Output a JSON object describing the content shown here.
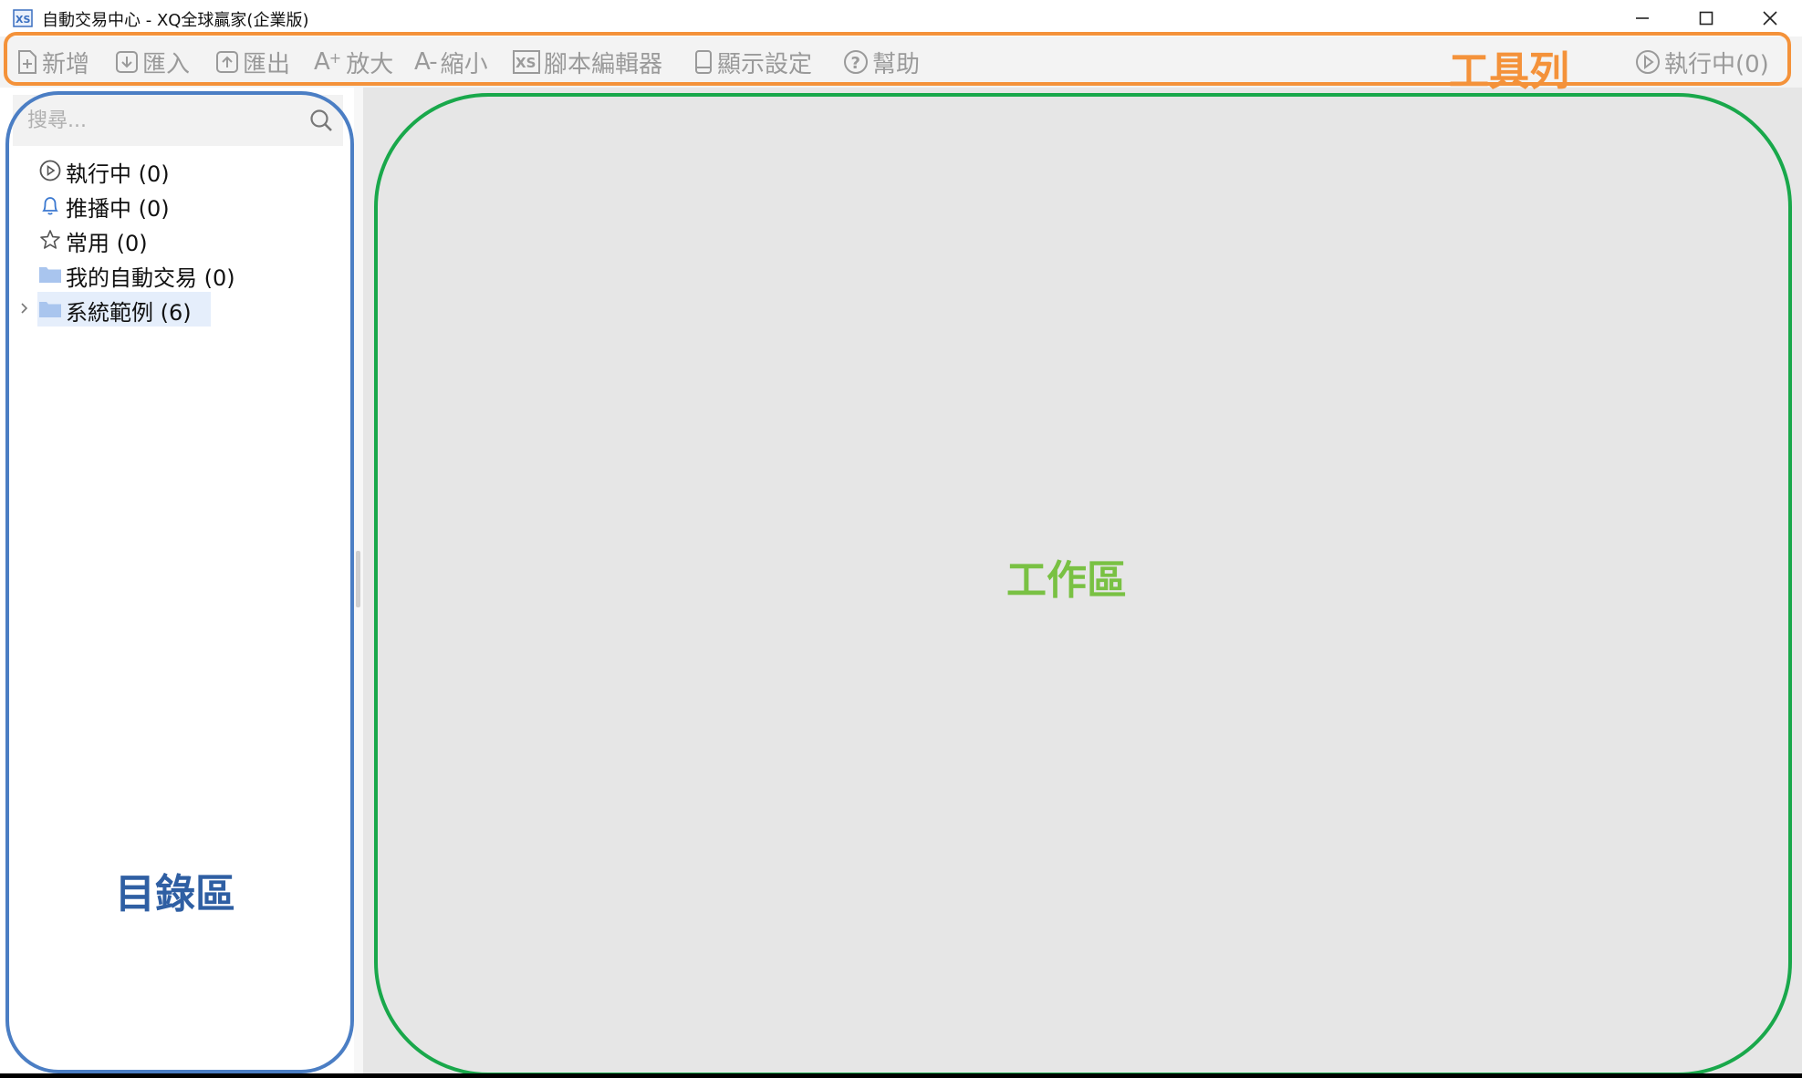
{
  "window": {
    "title": "自動交易中心 - XQ全球贏家(企業版)",
    "app_icon": "xs-logo-icon",
    "controls": [
      "minimize-icon",
      "maximize-icon",
      "close-icon"
    ]
  },
  "toolbar": {
    "new_label": "新增",
    "import_label": "匯入",
    "export_label": "匯出",
    "zoom_in_prefix": "A",
    "zoom_in_label": "放大",
    "zoom_out_prefix": "A-",
    "zoom_out_label": "縮小",
    "script_editor_label": "腳本編輯器",
    "display_settings_label": "顯示設定",
    "help_label": "幫助",
    "running_label": "執行中(0)"
  },
  "search": {
    "placeholder": "搜尋..."
  },
  "tree": {
    "items": [
      {
        "label": "執行中 (0)",
        "icon": "play-circle-icon"
      },
      {
        "label": "推播中 (0)",
        "icon": "bell-icon"
      },
      {
        "label": "常用 (0)",
        "icon": "star-icon"
      },
      {
        "label": "我的自動交易 (0)",
        "icon": "folder-icon"
      },
      {
        "label": "系統範例 (6)",
        "icon": "folder-icon",
        "expandable": true,
        "selected": true
      }
    ]
  },
  "annotations": {
    "toolbar_label": "工具列",
    "directory_label": "目錄區",
    "workarea_label": "工作區"
  },
  "colors": {
    "toolbar_annotation": "#f4923a",
    "directory_annotation": "#4b7ec4",
    "workarea_annotation": "#19a84b",
    "workarea_text": "#79c143",
    "folder": "#a9c5ee"
  }
}
